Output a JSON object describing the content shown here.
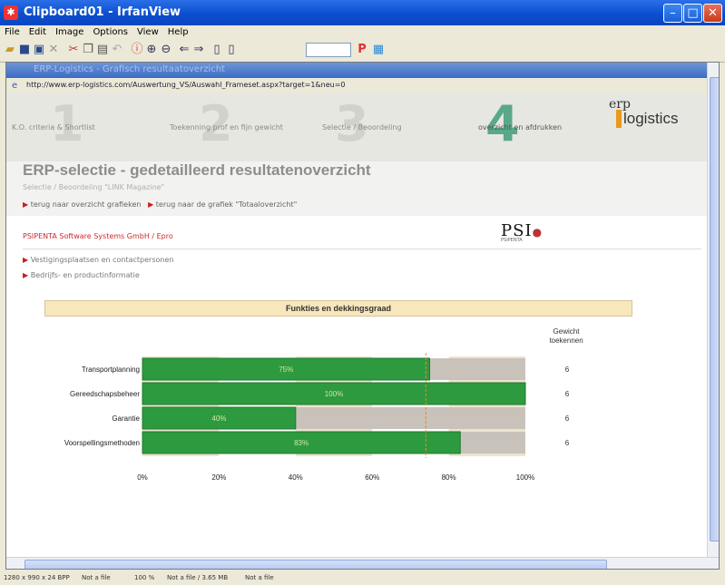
{
  "window": {
    "title": "Clipboard01 - IrfanView"
  },
  "menu": [
    "File",
    "Edit",
    "Image",
    "Options",
    "View",
    "Help"
  ],
  "toolbar": {
    "input_value": ""
  },
  "browser": {
    "title": "ERP-Logistics - Grafisch resultaatoverzicht",
    "url": "http://www.erp-logistics.com/Auswertung_VS/Auswahl_Frameset.aspx?target=1&neu=0"
  },
  "steps": [
    {
      "num": "1",
      "label": "K.O. criteria & Shortlist"
    },
    {
      "num": "2",
      "label": "Toekenning prof en fijn gewicht"
    },
    {
      "num": "3",
      "label": "Selectie / Beoordeling"
    },
    {
      "num": "4",
      "label": "overzicht en afdrukken"
    }
  ],
  "logo": {
    "erp": "erp",
    "logistics": "logistics"
  },
  "page": {
    "heading": "ERP-selectie - gedetailleerd resultatenoverzicht",
    "subheading": "Selectie / Beoordeling \"LINK Magazine\"",
    "link1": "terug naar overzicht grafieken",
    "link2": "terug naar de grafiek \"Totaaloverzicht\""
  },
  "company": {
    "name": "PSIPENTA Software Systems GmbH / Epro",
    "logo_text": "PSI",
    "logo_sub": "PSIPENTA"
  },
  "sublinks": [
    "Vestigingsplaatsen en contactpersonen",
    "Bedrijfs- en productinformatie"
  ],
  "section": {
    "banner": "Funkties en dekkingsgraad",
    "gewicht_line1": "Gewicht",
    "gewicht_line2": "toekennen"
  },
  "chart_data": {
    "type": "bar",
    "orientation": "horizontal",
    "categories": [
      "Transportplanning",
      "Gereedschapsbeheer",
      "Garantie",
      "Voorspellingsmethoden"
    ],
    "values": [
      75,
      100,
      40,
      83
    ],
    "value_labels": [
      "75%",
      "100%",
      "40%",
      "83%"
    ],
    "weights": [
      "6",
      "6",
      "6",
      "6"
    ],
    "x_ticks": [
      "0%",
      "20%",
      "40%",
      "60%",
      "80%",
      "100%"
    ],
    "xlim": [
      0,
      100
    ],
    "reference_line": 74,
    "colors": {
      "bar": "#2e9a3f",
      "bar_dark": "#1f7a2e",
      "track": "#c8c2bb",
      "band": "#ede3cf",
      "ref": "#e6892a"
    }
  },
  "status": {
    "dims": "1280 x 990 x 24 BPP",
    "file1": "Not a file",
    "zoom": "100 %",
    "file2": "Not a file / 3.65 MB",
    "file3": "Not a file"
  }
}
